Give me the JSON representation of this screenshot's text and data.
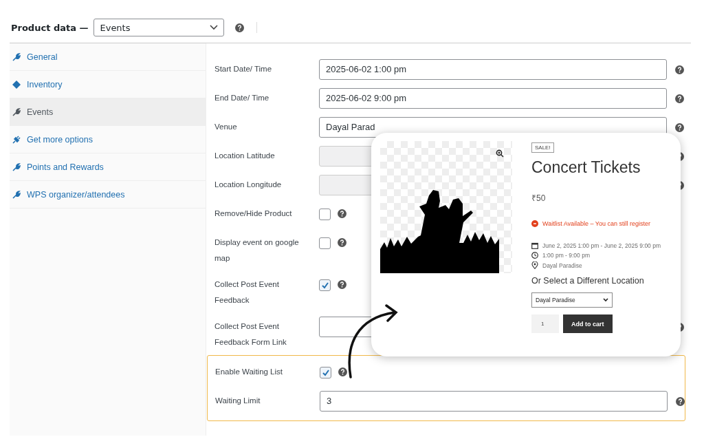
{
  "header": {
    "title": "Product data —",
    "product_type": "Events"
  },
  "tabs": [
    {
      "label": "General",
      "selected": false
    },
    {
      "label": "Inventory",
      "selected": false
    },
    {
      "label": "Events",
      "selected": true
    },
    {
      "label": "Get more options",
      "selected": false
    },
    {
      "label": "Points and Rewards",
      "selected": false
    },
    {
      "label": "WPS organizer/attendees",
      "selected": false
    }
  ],
  "fields": [
    {
      "kind": "text",
      "label": "Start Date/ Time",
      "value": "2025-06-02 1:00 pm",
      "disabled": false
    },
    {
      "kind": "text",
      "label": "End Date/ Time",
      "value": "2025-06-02 9:00 pm",
      "disabled": false
    },
    {
      "kind": "text",
      "label": "Venue",
      "value": "Dayal Parad",
      "disabled": false
    },
    {
      "kind": "text",
      "label": "Location Latitude",
      "disabled": true
    },
    {
      "kind": "text",
      "label": "Location Longitude",
      "disabled": true
    },
    {
      "kind": "checkbox",
      "label": "Remove/Hide Product",
      "checked": false
    },
    {
      "kind": "checkbox",
      "label": "Display event on google map",
      "checked": false
    },
    {
      "kind": "checkbox",
      "label": "Collect Post Event Feedback",
      "checked": true
    },
    {
      "kind": "text",
      "label": "Collect Post Event Feedback Form Link",
      "disabled": false
    }
  ],
  "waiting_list_section": [
    {
      "kind": "checkbox",
      "label": "Enable Waiting List",
      "checked": true
    },
    {
      "kind": "text",
      "label": "Waiting Limit",
      "value": "3",
      "disabled": false
    }
  ],
  "preview": {
    "badge": "SALE!",
    "title": "Concert Tickets",
    "price": "₹50",
    "notice": "Waitlist Available – You can still register",
    "date_range": "June 2, 2025 1:00 pm - June 2, 2025 9:00 pm",
    "time_range": "1:00 pm - 9:00 pm",
    "venue": "Dayal Paradise",
    "location_heading": "Or Select a Different Location",
    "location_select": "Dayal Paradise",
    "quantity": "1",
    "cart_button": "Add to cart"
  }
}
